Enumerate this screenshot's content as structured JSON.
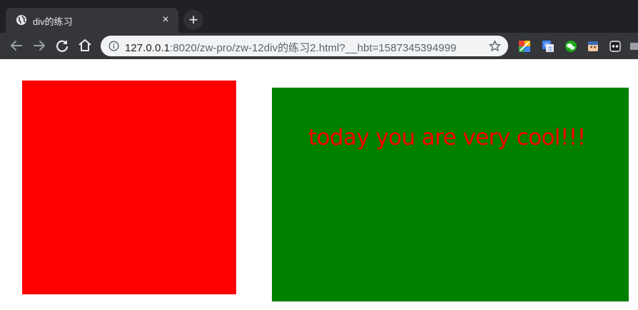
{
  "browser": {
    "tab": {
      "title": "div的练习",
      "close_glyph": "×",
      "favicon": "globe-icon"
    },
    "new_tab_glyph": "+",
    "address_bar": {
      "host": "127.0.0.1",
      "path": ":8020/zw-pro/zw-12div的练习2.html?__hbt=1587345394999"
    },
    "extensions": [
      "colorful-extension-icon",
      "translate-icon",
      "wechat-icon",
      "character-icon",
      "robot-icon",
      "more-extensions-icon"
    ]
  },
  "page": {
    "red_box_color": "#ff0000",
    "green_box_color": "#008000",
    "green_box_text": "today you are very cool!!!"
  }
}
